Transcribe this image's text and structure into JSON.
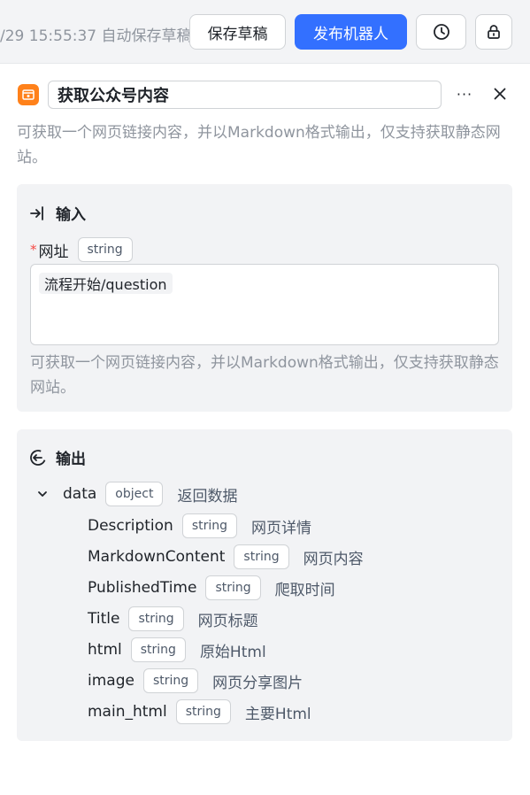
{
  "topbar": {
    "save_status": "/29 15:55:37 自动保存草稿",
    "save_draft_label": "保存草稿",
    "publish_label": "发布机器人"
  },
  "node": {
    "title": "获取公众号内容",
    "more_label": "···",
    "description": "可获取一个网页链接内容，并以Markdown格式输出，仅支持获取静态网站。"
  },
  "input_section": {
    "heading": "输入",
    "field_label": "网址",
    "required_mark": "*",
    "field_type": "string",
    "field_value": "流程开始/question",
    "field_description": "可获取一个网页链接内容，并以Markdown格式输出，仅支持获取静态网站。"
  },
  "output_section": {
    "heading": "输出",
    "root": {
      "name": "data",
      "type": "object",
      "desc": "返回数据"
    },
    "children": [
      {
        "name": "Description",
        "type": "string",
        "desc": "网页详情"
      },
      {
        "name": "MarkdownContent",
        "type": "string",
        "desc": "网页内容"
      },
      {
        "name": "PublishedTime",
        "type": "string",
        "desc": "爬取时间"
      },
      {
        "name": "Title",
        "type": "string",
        "desc": "网页标题"
      },
      {
        "name": "html",
        "type": "string",
        "desc": "原始Html"
      },
      {
        "name": "image",
        "type": "string",
        "desc": "网页分享图片"
      },
      {
        "name": "main_html",
        "type": "string",
        "desc": "主要Html"
      }
    ]
  },
  "colors": {
    "accent": "#3370ff",
    "node_icon": "#ff811a",
    "required": "#f54a45"
  },
  "icons": [
    "history-clock-icon",
    "lock-icon",
    "plugin-node-icon",
    "more-icon",
    "close-icon",
    "input-arrow-icon",
    "output-arrow-icon",
    "chevron-down-icon"
  ]
}
